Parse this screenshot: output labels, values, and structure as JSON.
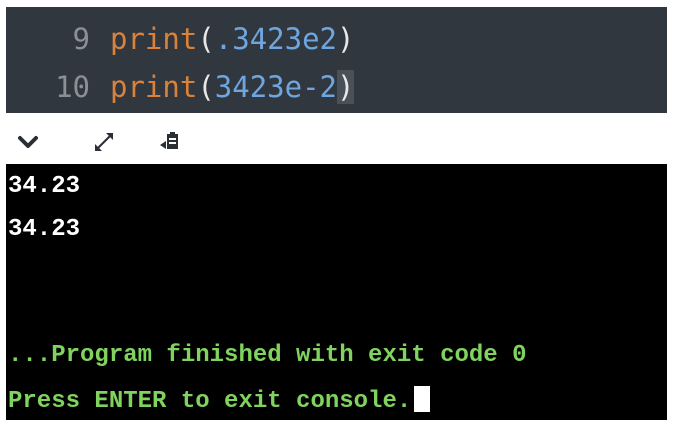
{
  "editor": {
    "lines": [
      {
        "number": "9",
        "fn": "print",
        "open": "(",
        "arg": ".3423e2",
        "close": ")"
      },
      {
        "number": "10",
        "fn": "print",
        "open": "(",
        "arg": "3423e-2",
        "close": ")"
      }
    ]
  },
  "toolbar": {
    "icons": [
      "chevron-down-icon",
      "expand-icon",
      "copy-icon"
    ]
  },
  "console": {
    "output": [
      "34.23",
      "34.23"
    ],
    "finished_message": "...Program finished with exit code 0",
    "prompt_message": "Press ENTER to exit console."
  },
  "colors": {
    "editor_bg": "#31373f",
    "keyword": "#d9823b",
    "number": "#6fa6e0",
    "console_bg": "#000000",
    "console_status": "#7fd35e"
  }
}
